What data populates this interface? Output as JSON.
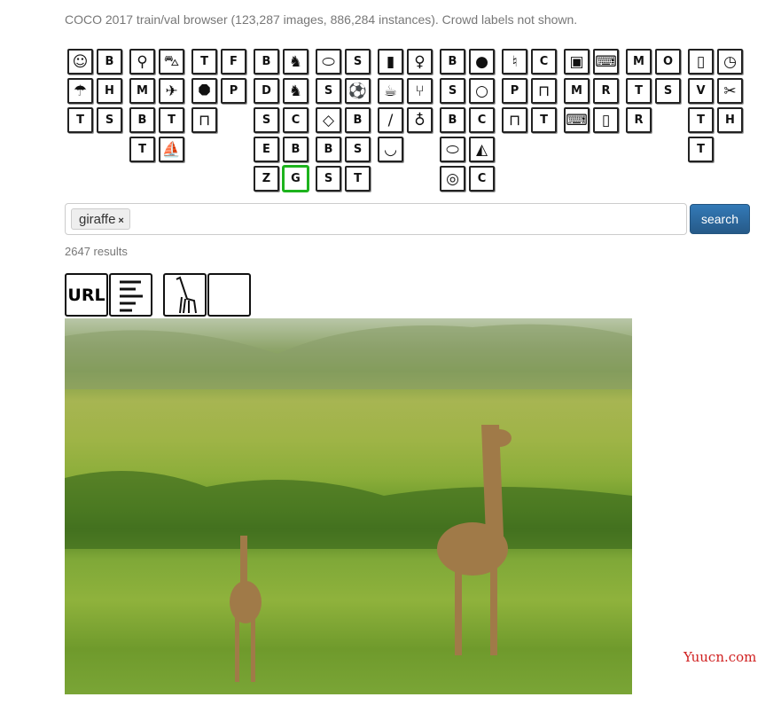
{
  "header": {
    "title": "COCO 2017 train/val browser (123,287 images, 886,284 instances). Crowd labels not shown."
  },
  "category_groups": [
    [
      [
        "person",
        "backpack"
      ],
      [
        "umbrella",
        "handbag"
      ],
      [
        "tie",
        "suitcase"
      ]
    ],
    [
      [
        "bicycle",
        "car"
      ],
      [
        "motorcycle",
        "airplane"
      ],
      [
        "bus",
        "train"
      ],
      [
        "truck",
        "boat"
      ]
    ],
    [
      [
        "traffic light",
        "fire hydrant"
      ],
      [
        "stop sign",
        "parking meter"
      ],
      [
        "bench"
      ]
    ],
    [
      [
        "bird",
        "cat"
      ],
      [
        "dog",
        "horse"
      ],
      [
        "sheep",
        "cow"
      ],
      [
        "elephant",
        "bear"
      ],
      [
        "zebra",
        "giraffe"
      ]
    ],
    [
      [
        "frisbee",
        "skis"
      ],
      [
        "snowboard",
        "sports ball"
      ],
      [
        "kite",
        "baseball bat"
      ],
      [
        "baseball glove",
        "skateboard"
      ],
      [
        "surfboard",
        "tennis racket"
      ]
    ],
    [
      [
        "bottle",
        "wine glass"
      ],
      [
        "cup",
        "fork"
      ],
      [
        "knife",
        "spoon"
      ],
      [
        "bowl"
      ]
    ],
    [
      [
        "banana",
        "apple"
      ],
      [
        "sandwich",
        "orange"
      ],
      [
        "broccoli",
        "carrot"
      ],
      [
        "hot dog",
        "pizza"
      ],
      [
        "donut",
        "cake"
      ]
    ],
    [
      [
        "chair",
        "couch"
      ],
      [
        "potted plant",
        "bed"
      ],
      [
        "dining table",
        "toilet"
      ]
    ],
    [
      [
        "tv",
        "laptop"
      ],
      [
        "mouse",
        "remote"
      ],
      [
        "keyboard",
        "cell phone"
      ]
    ],
    [
      [
        "microwave",
        "oven"
      ],
      [
        "toaster",
        "sink"
      ],
      [
        "refrigerator"
      ]
    ],
    [
      [
        "book",
        "clock"
      ],
      [
        "vase",
        "scissors"
      ],
      [
        "teddy bear",
        "hair drier"
      ],
      [
        "toothbrush"
      ]
    ]
  ],
  "selected_category": "giraffe",
  "search": {
    "tags": [
      {
        "label": "giraffe",
        "remove_icon": "×"
      }
    ],
    "button_label": "search"
  },
  "results": {
    "count_text": "2647 results"
  },
  "toolbar": {
    "url_label": "URL",
    "items": [
      "url-icon",
      "caption-lines-icon",
      "giraffe-segmentation-icon",
      "blank-icon"
    ]
  },
  "watermark": "Yuucn.com",
  "colors": {
    "selected_border": "#1db31d",
    "search_button": "#2e6da4",
    "watermark": "#d02020"
  }
}
